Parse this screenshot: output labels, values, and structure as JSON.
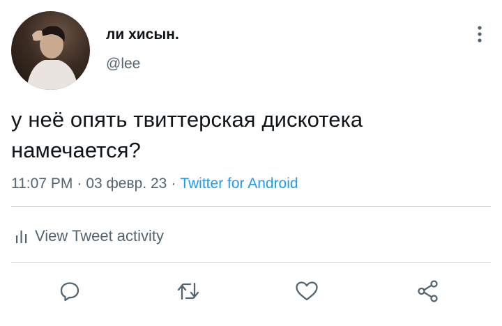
{
  "user": {
    "display_name": "ли хисын.",
    "handle": "@lee"
  },
  "tweet": {
    "text": "у неё опять твиттерская дискотека намечается?",
    "time": "11:07 PM",
    "date": "03 февр. 23",
    "separator": "·",
    "source": "Twitter for Android"
  },
  "activity": {
    "label": "View Tweet activity"
  },
  "icons": {
    "more": "more-vertical-icon",
    "activity": "bar-chart-icon",
    "reply": "reply-icon",
    "retweet": "retweet-icon",
    "like": "heart-icon",
    "share": "share-icon"
  },
  "colors": {
    "text": "#0f1419",
    "muted": "#536471",
    "link": "#1d9bf0",
    "divider": "#cfd9de"
  }
}
